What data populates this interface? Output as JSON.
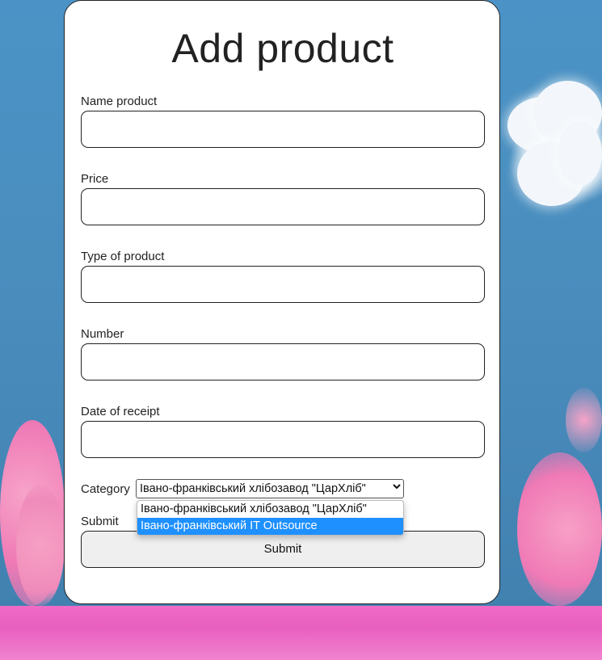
{
  "form": {
    "title": "Add product",
    "fields": [
      {
        "label": "Name product",
        "value": ""
      },
      {
        "label": "Price",
        "value": ""
      },
      {
        "label": "Type of product",
        "value": ""
      },
      {
        "label": "Number",
        "value": ""
      },
      {
        "label": "Date of receipt",
        "value": ""
      }
    ],
    "category": {
      "label": "Category",
      "selected": "Івано-франківський хлібозавод \"ЦарХліб\"",
      "options": [
        "Івано-франківський хлібозавод \"ЦарХліб\"",
        "Івано-франківський IT Outsource"
      ],
      "highlighted_option": "Івано-франківський IT Outsource"
    },
    "submit_label": "Submit",
    "submit_button": "Submit"
  },
  "colors": {
    "sky": "#4a8fc0",
    "blossom": "#f06bc6",
    "highlight": "#1e90ff"
  }
}
